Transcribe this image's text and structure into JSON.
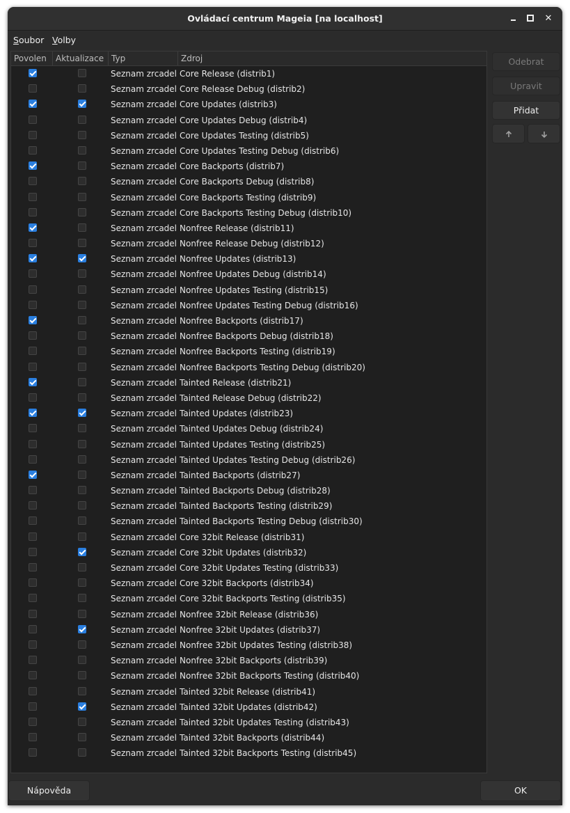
{
  "window": {
    "title": "Ovládací centrum Mageia  [na localhost]"
  },
  "menu": [
    {
      "label": "Soubor"
    },
    {
      "label": "Volby"
    }
  ],
  "columns": {
    "povolen": "Povolen",
    "aktualizace": "Aktualizace",
    "typ": "Typ",
    "zdroj": "Zdroj"
  },
  "rows": [
    {
      "enabled": true,
      "update": false,
      "type": "Seznam zrcadel",
      "source": "Core Release (distrib1)"
    },
    {
      "enabled": false,
      "update": false,
      "type": "Seznam zrcadel",
      "source": "Core Release Debug (distrib2)"
    },
    {
      "enabled": true,
      "update": true,
      "type": "Seznam zrcadel",
      "source": "Core Updates (distrib3)"
    },
    {
      "enabled": false,
      "update": false,
      "type": "Seznam zrcadel",
      "source": "Core Updates Debug (distrib4)"
    },
    {
      "enabled": false,
      "update": false,
      "type": "Seznam zrcadel",
      "source": "Core Updates Testing (distrib5)"
    },
    {
      "enabled": false,
      "update": false,
      "type": "Seznam zrcadel",
      "source": "Core Updates Testing Debug (distrib6)"
    },
    {
      "enabled": true,
      "update": false,
      "type": "Seznam zrcadel",
      "source": "Core Backports (distrib7)"
    },
    {
      "enabled": false,
      "update": false,
      "type": "Seznam zrcadel",
      "source": "Core Backports Debug (distrib8)"
    },
    {
      "enabled": false,
      "update": false,
      "type": "Seznam zrcadel",
      "source": "Core Backports Testing (distrib9)"
    },
    {
      "enabled": false,
      "update": false,
      "type": "Seznam zrcadel",
      "source": "Core Backports Testing Debug (distrib10)"
    },
    {
      "enabled": true,
      "update": false,
      "type": "Seznam zrcadel",
      "source": "Nonfree Release (distrib11)"
    },
    {
      "enabled": false,
      "update": false,
      "type": "Seznam zrcadel",
      "source": "Nonfree Release Debug (distrib12)"
    },
    {
      "enabled": true,
      "update": true,
      "type": "Seznam zrcadel",
      "source": "Nonfree Updates (distrib13)"
    },
    {
      "enabled": false,
      "update": false,
      "type": "Seznam zrcadel",
      "source": "Nonfree Updates Debug (distrib14)"
    },
    {
      "enabled": false,
      "update": false,
      "type": "Seznam zrcadel",
      "source": "Nonfree Updates Testing (distrib15)"
    },
    {
      "enabled": false,
      "update": false,
      "type": "Seznam zrcadel",
      "source": "Nonfree Updates Testing Debug (distrib16)"
    },
    {
      "enabled": true,
      "update": false,
      "type": "Seznam zrcadel",
      "source": "Nonfree Backports (distrib17)"
    },
    {
      "enabled": false,
      "update": false,
      "type": "Seznam zrcadel",
      "source": "Nonfree Backports Debug (distrib18)"
    },
    {
      "enabled": false,
      "update": false,
      "type": "Seznam zrcadel",
      "source": "Nonfree Backports Testing (distrib19)"
    },
    {
      "enabled": false,
      "update": false,
      "type": "Seznam zrcadel",
      "source": "Nonfree Backports Testing Debug (distrib20)"
    },
    {
      "enabled": true,
      "update": false,
      "type": "Seznam zrcadel",
      "source": "Tainted Release (distrib21)"
    },
    {
      "enabled": false,
      "update": false,
      "type": "Seznam zrcadel",
      "source": "Tainted Release Debug (distrib22)"
    },
    {
      "enabled": true,
      "update": true,
      "type": "Seznam zrcadel",
      "source": "Tainted Updates (distrib23)"
    },
    {
      "enabled": false,
      "update": false,
      "type": "Seznam zrcadel",
      "source": "Tainted Updates Debug (distrib24)"
    },
    {
      "enabled": false,
      "update": false,
      "type": "Seznam zrcadel",
      "source": "Tainted Updates Testing (distrib25)"
    },
    {
      "enabled": false,
      "update": false,
      "type": "Seznam zrcadel",
      "source": "Tainted Updates Testing Debug (distrib26)"
    },
    {
      "enabled": true,
      "update": false,
      "type": "Seznam zrcadel",
      "source": "Tainted Backports (distrib27)"
    },
    {
      "enabled": false,
      "update": false,
      "type": "Seznam zrcadel",
      "source": "Tainted Backports Debug (distrib28)"
    },
    {
      "enabled": false,
      "update": false,
      "type": "Seznam zrcadel",
      "source": "Tainted Backports Testing (distrib29)"
    },
    {
      "enabled": false,
      "update": false,
      "type": "Seznam zrcadel",
      "source": "Tainted Backports Testing Debug (distrib30)"
    },
    {
      "enabled": false,
      "update": false,
      "type": "Seznam zrcadel",
      "source": "Core 32bit Release (distrib31)"
    },
    {
      "enabled": false,
      "update": true,
      "type": "Seznam zrcadel",
      "source": "Core 32bit Updates (distrib32)"
    },
    {
      "enabled": false,
      "update": false,
      "type": "Seznam zrcadel",
      "source": "Core 32bit Updates Testing (distrib33)"
    },
    {
      "enabled": false,
      "update": false,
      "type": "Seznam zrcadel",
      "source": "Core 32bit Backports (distrib34)"
    },
    {
      "enabled": false,
      "update": false,
      "type": "Seznam zrcadel",
      "source": "Core 32bit Backports Testing (distrib35)"
    },
    {
      "enabled": false,
      "update": false,
      "type": "Seznam zrcadel",
      "source": "Nonfree 32bit Release (distrib36)"
    },
    {
      "enabled": false,
      "update": true,
      "type": "Seznam zrcadel",
      "source": "Nonfree 32bit Updates (distrib37)"
    },
    {
      "enabled": false,
      "update": false,
      "type": "Seznam zrcadel",
      "source": "Nonfree 32bit Updates Testing (distrib38)"
    },
    {
      "enabled": false,
      "update": false,
      "type": "Seznam zrcadel",
      "source": "Nonfree 32bit Backports (distrib39)"
    },
    {
      "enabled": false,
      "update": false,
      "type": "Seznam zrcadel",
      "source": "Nonfree 32bit Backports Testing (distrib40)"
    },
    {
      "enabled": false,
      "update": false,
      "type": "Seznam zrcadel",
      "source": "Tainted 32bit Release (distrib41)"
    },
    {
      "enabled": false,
      "update": true,
      "type": "Seznam zrcadel",
      "source": "Tainted 32bit Updates (distrib42)"
    },
    {
      "enabled": false,
      "update": false,
      "type": "Seznam zrcadel",
      "source": "Tainted 32bit Updates Testing (distrib43)"
    },
    {
      "enabled": false,
      "update": false,
      "type": "Seznam zrcadel",
      "source": "Tainted 32bit Backports (distrib44)"
    },
    {
      "enabled": false,
      "update": false,
      "type": "Seznam zrcadel",
      "source": "Tainted 32bit Backports Testing (distrib45)"
    }
  ],
  "side_buttons": {
    "remove": {
      "label": "Odebrat",
      "enabled": false
    },
    "edit": {
      "label": "Upravit",
      "enabled": false
    },
    "add": {
      "label": "Přidat",
      "enabled": true
    },
    "move_up_icon": "arrow-up-icon",
    "move_down_icon": "arrow-down-icon"
  },
  "bottom_buttons": {
    "help": "Nápověda",
    "ok": "OK"
  },
  "colors": {
    "window_bg": "#2b2b2b",
    "list_bg": "#1f1f1f",
    "check_accent": "#2a7fe0"
  }
}
